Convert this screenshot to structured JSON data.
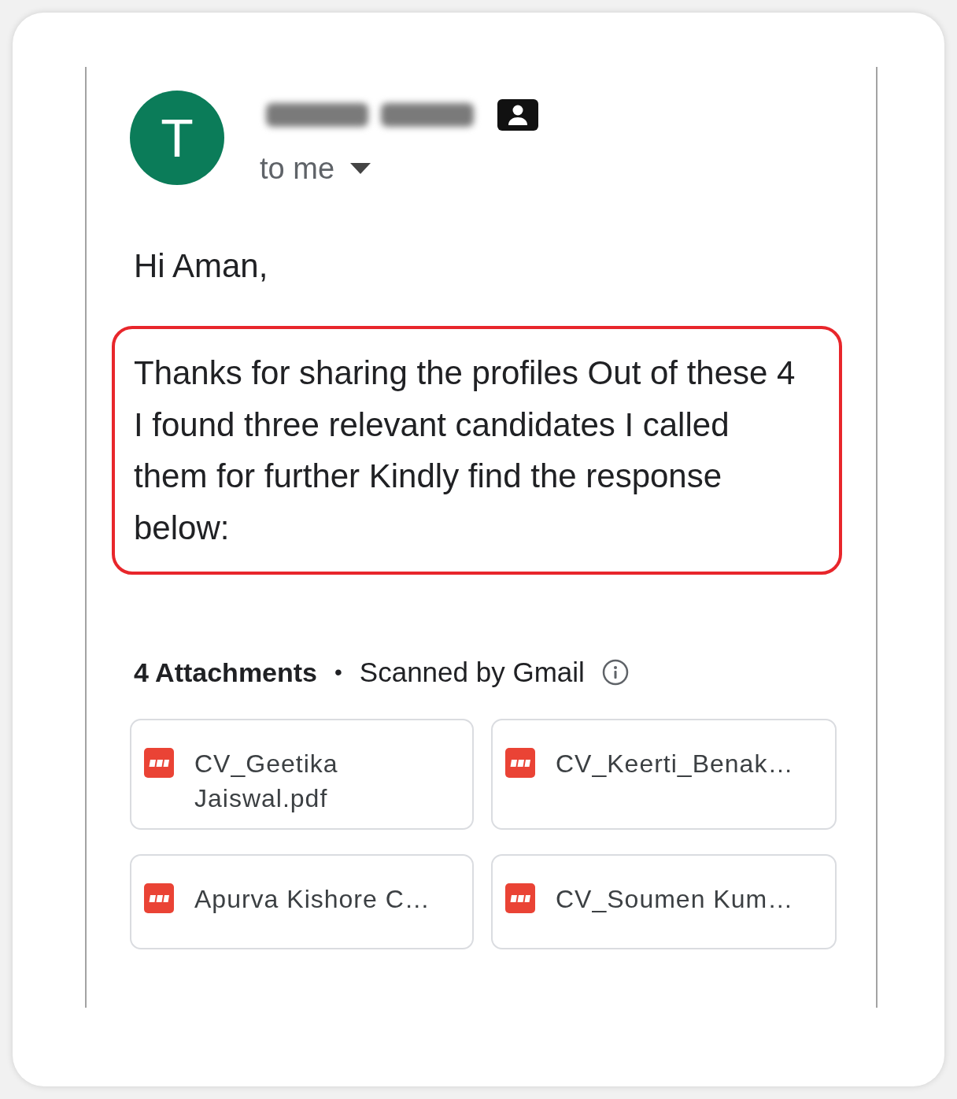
{
  "message": {
    "avatar_letter": "T",
    "recipient_label": "to me",
    "greeting": "Hi Aman,",
    "body": {
      "text": "Thanks for sharing the profiles Out of these 4 I found three relevant candidates I called them for further Kindly find the response below:",
      "highlighted": true
    }
  },
  "attachments": {
    "count_label": "4 Attachments",
    "separator": "•",
    "scan_note": "Scanned by Gmail",
    "files": [
      {
        "name": "CV_Geetika Jaiswal.pdf"
      },
      {
        "name": "CV_Keerti_Benak…"
      },
      {
        "name": "Apurva Kishore C…"
      },
      {
        "name": "CV_Soumen Kum…"
      }
    ]
  }
}
